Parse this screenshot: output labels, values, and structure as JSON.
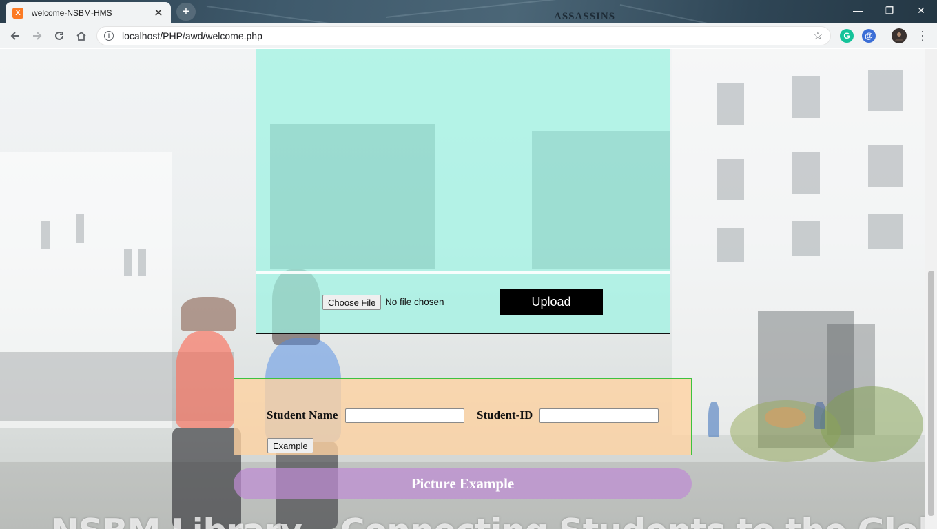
{
  "browser": {
    "tab_title": "welcome-NSBM-HMS",
    "tab_favicon_letter": "X",
    "new_tab_symbol": "+",
    "brand_text": "ASSASSINS",
    "url": "localhost/PHP/awd/welcome.php",
    "icons": {
      "back": "back-arrow-icon",
      "forward": "forward-arrow-icon",
      "reload": "reload-icon",
      "home": "home-icon",
      "bookmark": "star-icon",
      "grammarly": "grammarly-icon",
      "extension": "extension-icon",
      "profile": "avatar",
      "menu": "kebab-menu-icon"
    },
    "window_controls": {
      "minimize": "—",
      "restore": "❐",
      "close": "✕"
    }
  },
  "page": {
    "upload": {
      "choose_file_label": "Choose File",
      "file_status": "No file chosen",
      "upload_label": "Upload"
    },
    "form": {
      "student_name_label": "Student Name",
      "student_name_value": "",
      "student_id_label": "Student-ID",
      "student_id_value": "",
      "example_label": "Example"
    },
    "picture_example_label": "Picture Example",
    "background_caption": "NSBM Library – Connecting Students to the Globe"
  },
  "colors": {
    "upload_panel": "#9cf2e2",
    "form_panel": "#ffd2a0",
    "form_border": "#3ec23e",
    "picture_button": "#be8cd2",
    "upload_button": "#000000"
  }
}
